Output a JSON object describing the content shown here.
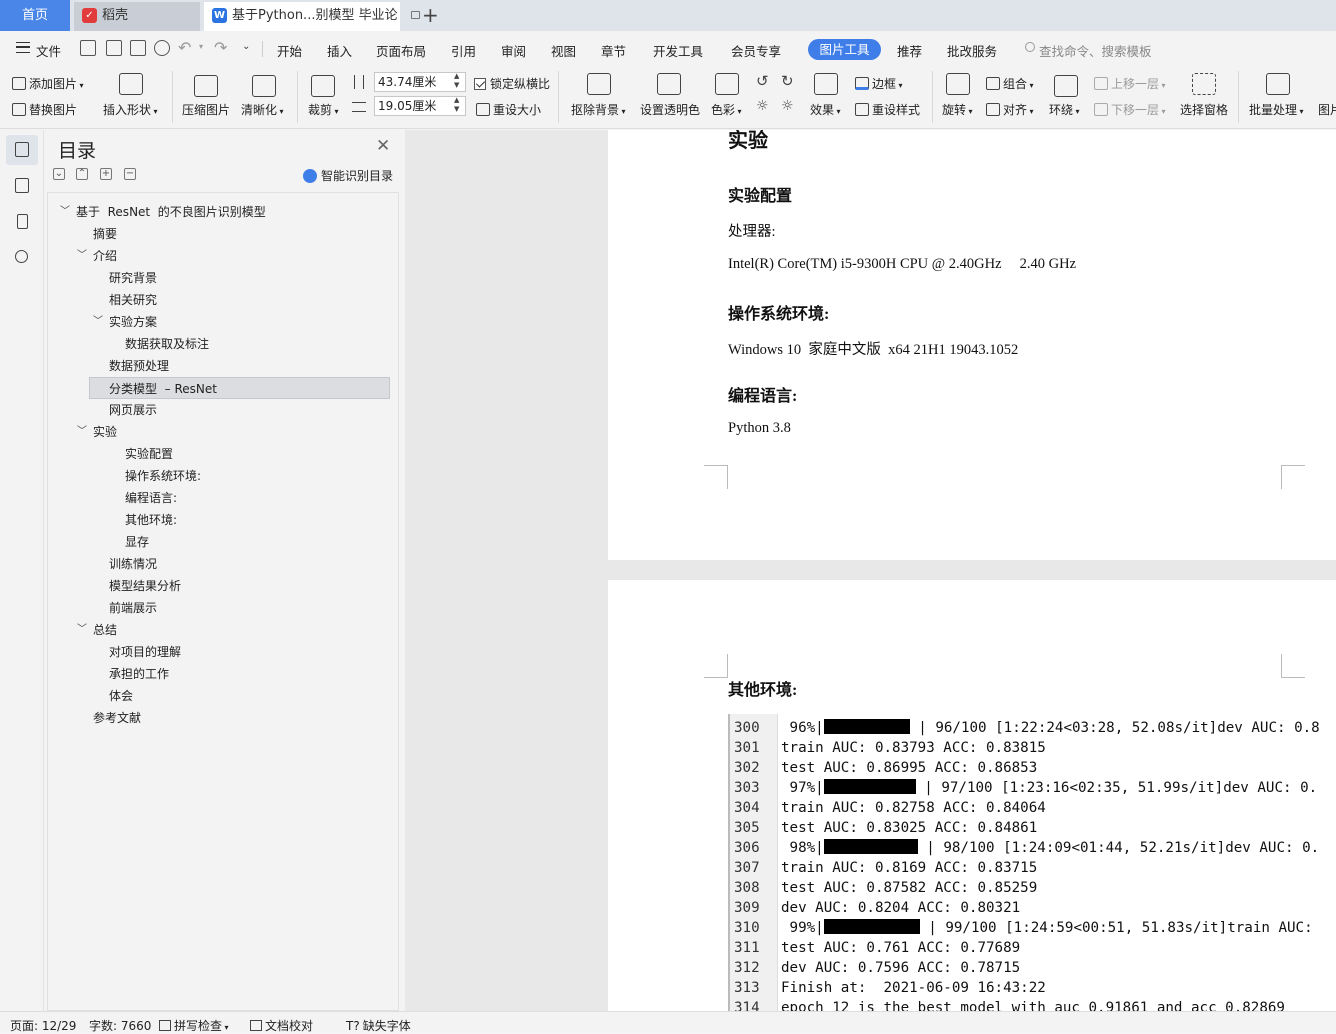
{
  "tabs": {
    "home": "首页",
    "docer": "稻壳",
    "document": "基于Python...别模型 毕业论文"
  },
  "menu": {
    "file": "文件",
    "items": [
      "开始",
      "插入",
      "页面布局",
      "引用",
      "审阅",
      "视图",
      "章节",
      "开发工具",
      "会员专享"
    ],
    "active": "图片工具",
    "after": [
      "推荐",
      "批改服务"
    ],
    "search": "查找命令、搜索模板"
  },
  "ribbon": {
    "add_image": "添加图片",
    "replace_image": "替换图片",
    "insert_shape": "插入形状",
    "compress": "压缩图片",
    "sharpen": "清晰化",
    "crop": "裁剪",
    "height": "43.74厘米",
    "width": "19.05厘米",
    "lock_ratio": "锁定纵横比",
    "reset_size": "重设大小",
    "remove_bg": "抠除背景",
    "transparency": "设置透明色",
    "color": "色彩",
    "effects": "效果",
    "border": "边框",
    "reset_style": "重设样式",
    "rotate": "旋转",
    "group": "组合",
    "align": "对齐",
    "wrap": "环绕",
    "bring_forward": "上移一层",
    "send_backward": "下移一层",
    "selection_pane": "选择窗格",
    "batch": "批量处理",
    "more": "图片"
  },
  "toc": {
    "title": "目录",
    "ai_detect": "智能识别目录",
    "items": [
      {
        "label": "基于  ResNet  的不良图片识别模型",
        "level": 0,
        "expand": "open"
      },
      {
        "label": "摘要",
        "level": 1
      },
      {
        "label": "介绍",
        "level": 1,
        "expand": "open"
      },
      {
        "label": "研究背景",
        "level": 2
      },
      {
        "label": "相关研究",
        "level": 2
      },
      {
        "label": "实验方案",
        "level": 2,
        "expand": "open"
      },
      {
        "label": "数据获取及标注",
        "level": 3
      },
      {
        "label": "数据预处理",
        "level": 2
      },
      {
        "label": "分类模型  – ResNet",
        "level": 2,
        "selected": true
      },
      {
        "label": "网页展示",
        "level": 2
      },
      {
        "label": "实验",
        "level": 1,
        "expand": "open"
      },
      {
        "label": "实验配置",
        "level": 3
      },
      {
        "label": "操作系统环境:",
        "level": 3
      },
      {
        "label": "编程语言:",
        "level": 3
      },
      {
        "label": "其他环境:",
        "level": 3
      },
      {
        "label": "显存",
        "level": 3
      },
      {
        "label": "训练情况",
        "level": 2
      },
      {
        "label": "模型结果分析",
        "level": 2
      },
      {
        "label": "前端展示",
        "level": 2
      },
      {
        "label": "总结",
        "level": 1,
        "expand": "open"
      },
      {
        "label": "对项目的理解",
        "level": 2
      },
      {
        "label": "承担的工作",
        "level": 2
      },
      {
        "label": "体会",
        "level": 2
      },
      {
        "label": "参考文献",
        "level": 1
      }
    ]
  },
  "doc": {
    "page1": {
      "partial_heading": "实验",
      "h_config": "实验配置",
      "cpu_label": "处理器:",
      "cpu_value": "Intel(R) Core(TM) i5-9300H CPU @ 2.40GHz     2.40 GHz",
      "h_os": "操作系统环境:",
      "os_value": "Windows 10  家庭中文版  x64 21H1 19043.1052",
      "h_lang": "编程语言:",
      "lang_value": "Python 3.8"
    },
    "page2": {
      "h_other": "其他环境:",
      "code_lines": [
        {
          "n": "300",
          "pre": " 96%|",
          "bar": 86,
          "post": " | 96/100 [1:22:24<03:28, 52.08s/it]dev AUC: 0.8"
        },
        {
          "n": "301",
          "pre": "train AUC: 0.83793 ACC: 0.83815"
        },
        {
          "n": "302",
          "pre": "test AUC: 0.86995 ACC: 0.86853"
        },
        {
          "n": "303",
          "pre": " 97%|",
          "bar": 92,
          "post": " | 97/100 [1:23:16<02:35, 51.99s/it]dev AUC: 0."
        },
        {
          "n": "304",
          "pre": "train AUC: 0.82758 ACC: 0.84064"
        },
        {
          "n": "305",
          "pre": "test AUC: 0.83025 ACC: 0.84861"
        },
        {
          "n": "306",
          "pre": " 98%|",
          "bar": 94,
          "post": " | 98/100 [1:24:09<01:44, 52.21s/it]dev AUC: 0."
        },
        {
          "n": "307",
          "pre": "train AUC: 0.8169 ACC: 0.83715"
        },
        {
          "n": "308",
          "pre": "test AUC: 0.87582 ACC: 0.85259"
        },
        {
          "n": "309",
          "pre": "dev AUC: 0.8204 ACC: 0.80321"
        },
        {
          "n": "310",
          "pre": " 99%|",
          "bar": 96,
          "post": " | 99/100 [1:24:59<00:51, 51.83s/it]train AUC: "
        },
        {
          "n": "311",
          "pre": "test AUC: 0.761 ACC: 0.77689"
        },
        {
          "n": "312",
          "pre": "dev AUC: 0.7596 ACC: 0.78715"
        },
        {
          "n": "313",
          "pre": "Finish at:  2021-06-09 16:43:22"
        },
        {
          "n": "314",
          "pre": "epoch 12 is the best model with auc 0.91861 and acc 0.82869"
        }
      ]
    }
  },
  "status": {
    "page": "页面: 12/29",
    "words": "字数: 7660",
    "spell": "拼写检查",
    "proof": "文档校对",
    "missing_font": "缺失字体"
  },
  "colors": {
    "accent": "#3f7ee8",
    "home_tab": "#4a86e8",
    "docer_red": "#e23b3b",
    "wps_blue": "#2b73e0"
  }
}
